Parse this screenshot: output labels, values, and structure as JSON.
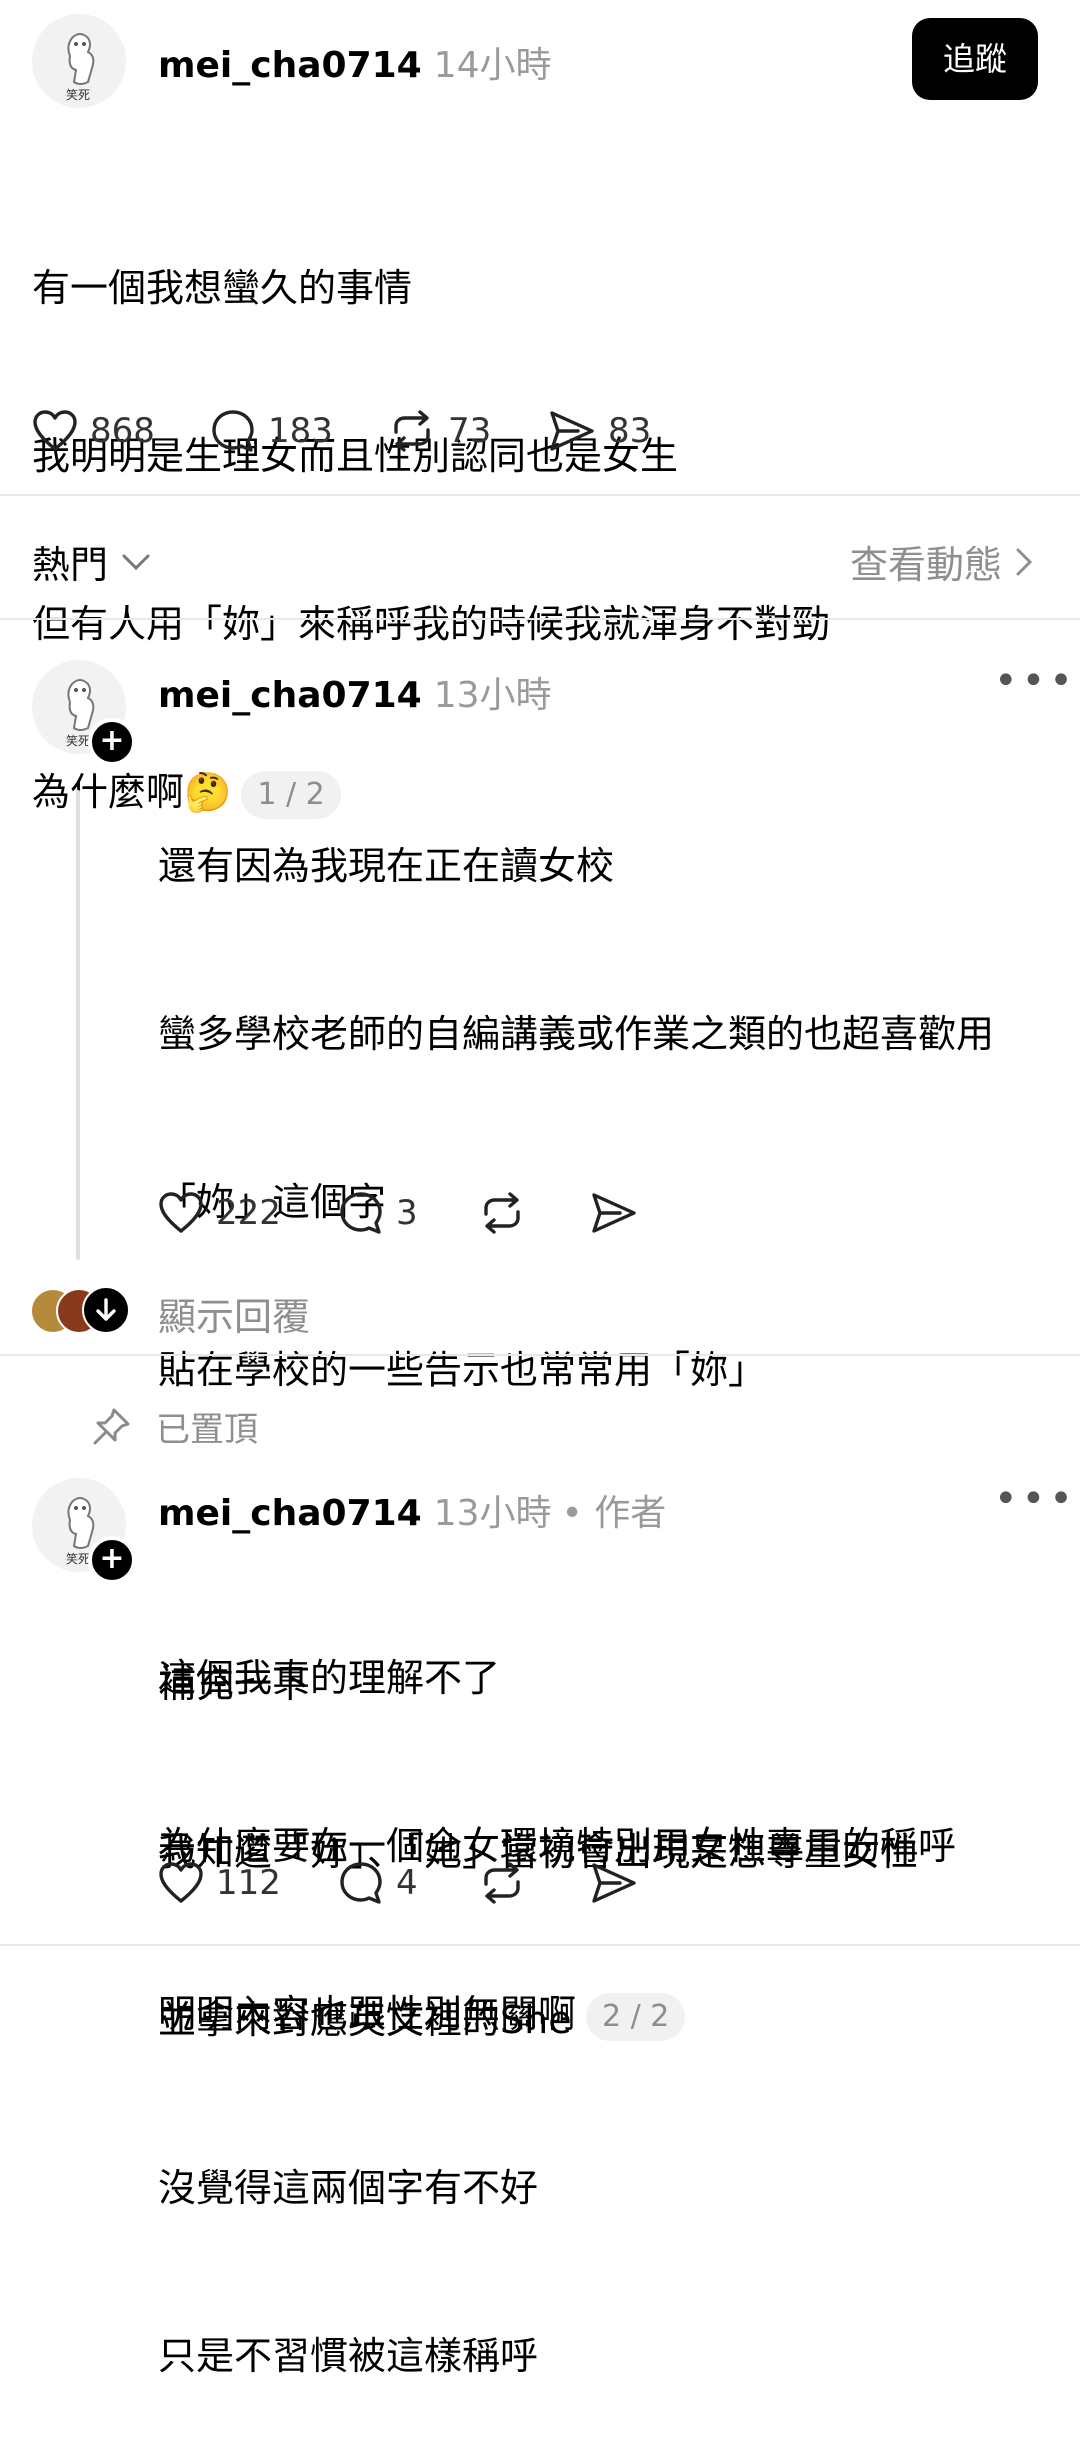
{
  "post": {
    "username": "mei_cha0714",
    "time": "14小時",
    "follow_label": "追蹤",
    "lines": [
      "有一個我想蠻久的事情",
      "我明明是生理女而且性別認同也是女生",
      "但有人用「妳」來稱呼我的時候我就渾身不對勁",
      "為什麼啊🤔"
    ],
    "page_indicator": "1 / 2",
    "stats": {
      "likes": "868",
      "comments": "183",
      "reposts": "73",
      "shares": "83"
    }
  },
  "sort_bar": {
    "label": "熱門",
    "view_activity": "查看動態"
  },
  "reply1": {
    "username": "mei_cha0714",
    "time": "13小時",
    "paragraph1": [
      "還有因為我現在正在讀女校",
      "蠻多學校老師的自編講義或作業之類的也超喜歡用",
      "「妳」這個字",
      "貼在學校的一些告示也常常用「妳」"
    ],
    "paragraph2": [
      "這個我真的理解不了",
      "為什麼要在一個全女環境特別用女性專用的稱呼",
      "明明內容也跟性別無關啊"
    ],
    "page_indicator": "2 / 2",
    "stats": {
      "likes": "222",
      "comments": "3"
    },
    "show_replies": "顯示回覆"
  },
  "pinned_label": "已置頂",
  "reply2": {
    "username": "mei_cha0714",
    "time": "13小時",
    "author_tag": "• 作者",
    "lines": [
      "補充一下",
      "我知道「妳」、「她」當初會出現是想尊重女性",
      "並拿來對應英文裡的She",
      "沒覺得這兩個字有不好",
      "只是不習慣被這樣稱呼"
    ],
    "stats": {
      "likes": "112",
      "comments": "4"
    }
  },
  "avatar_caption": "笑死",
  "colors": {
    "text": "#000000",
    "muted": "#9a9a9a",
    "divider": "#e8e8e8",
    "button": "#000000"
  }
}
